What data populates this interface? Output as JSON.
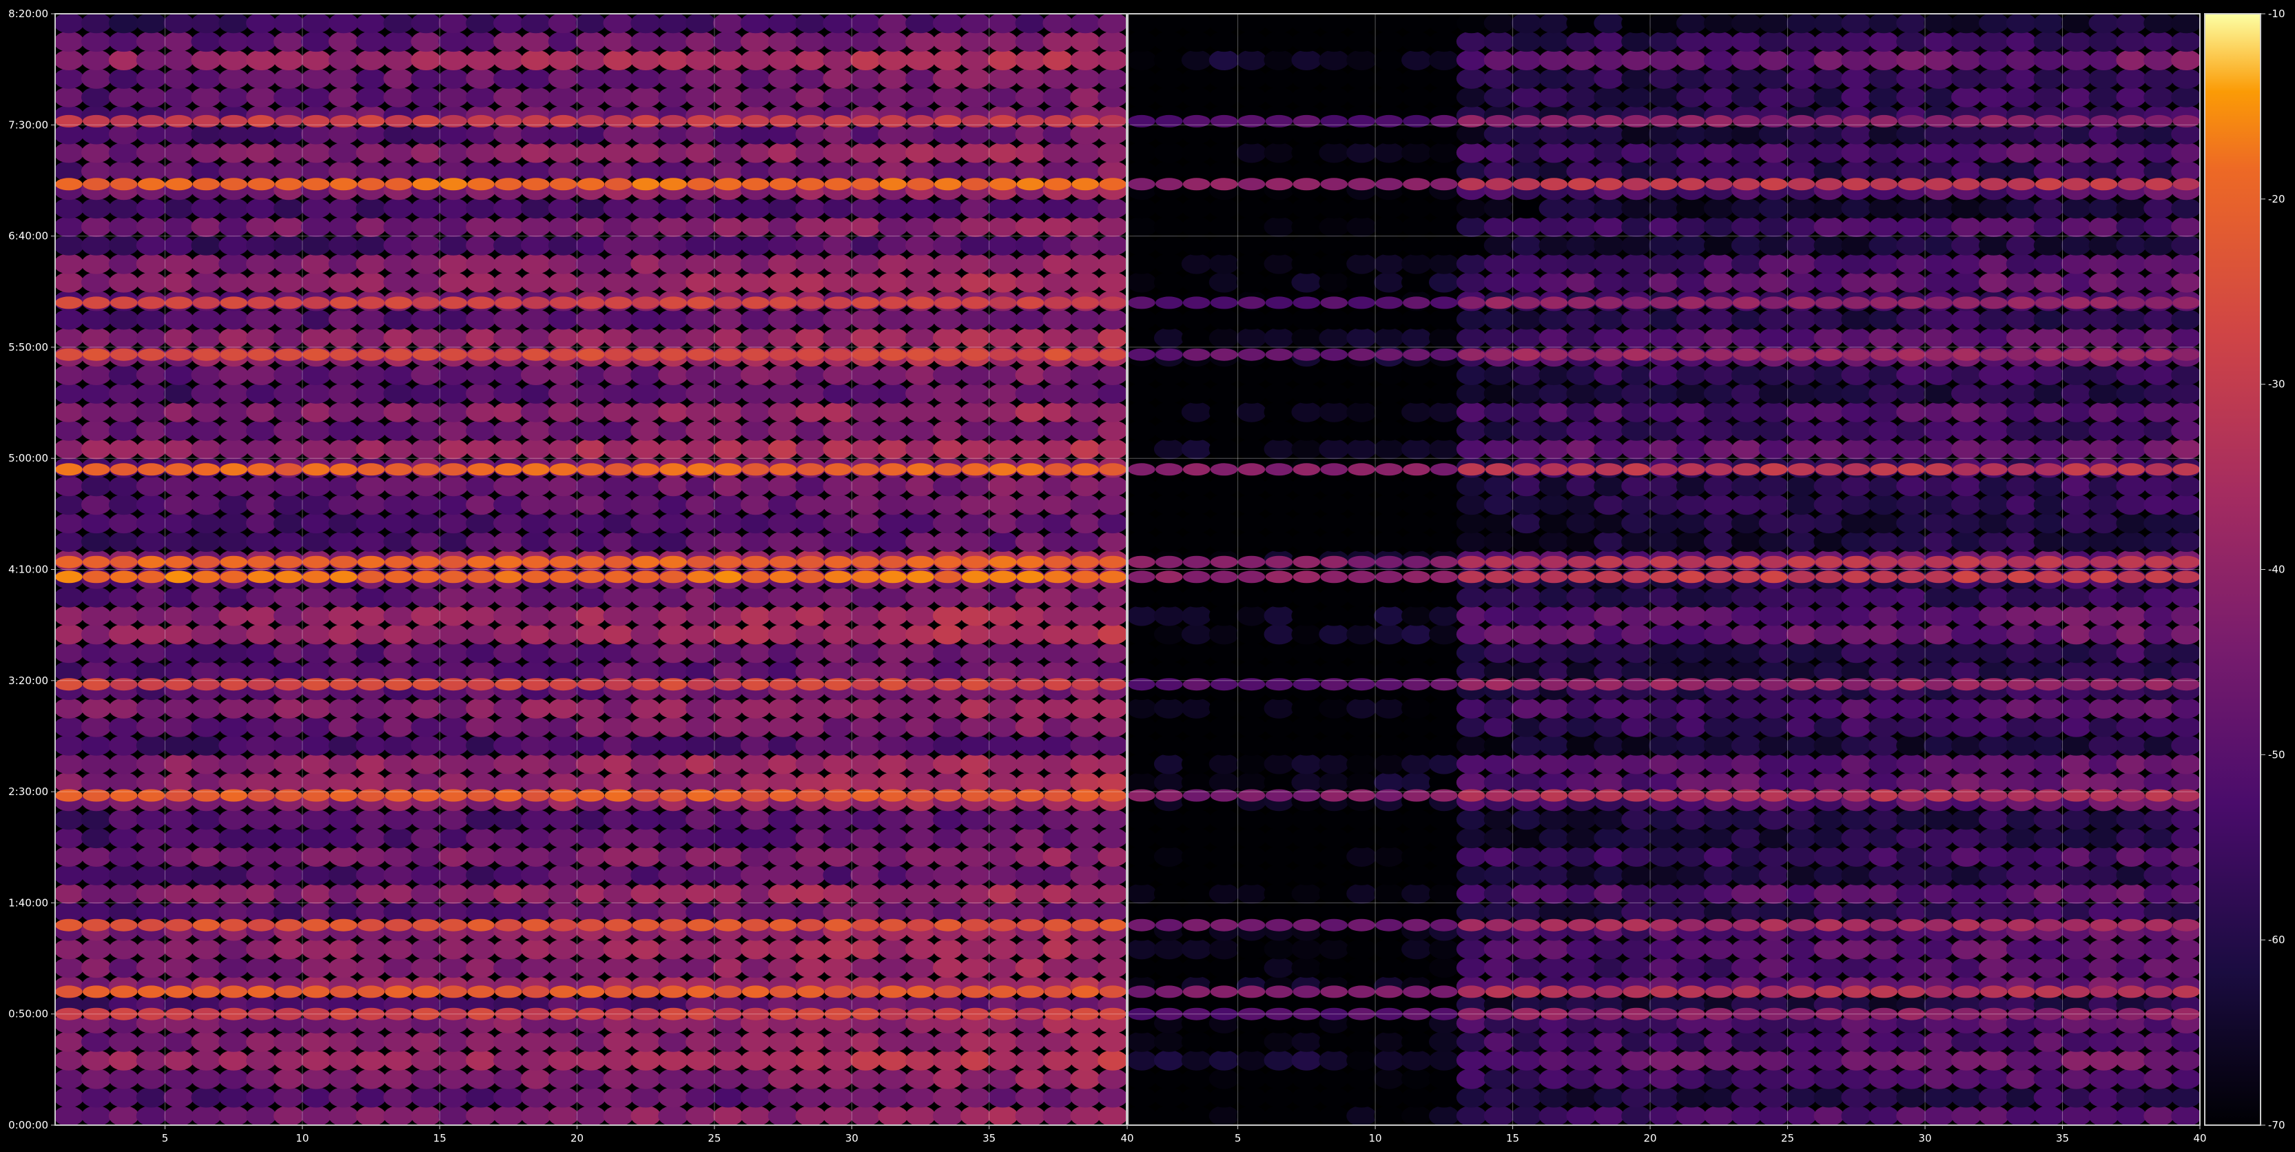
{
  "chart_data": {
    "type": "heatmap",
    "title": "",
    "xlabel": "",
    "ylabel": "",
    "colormap": "inferno",
    "background": "#000000",
    "grid": true,
    "colorbar": {
      "placement": "right",
      "range": [
        -70,
        -10
      ],
      "ticks": [
        -10,
        -20,
        -30,
        -40,
        -50,
        -60,
        -70
      ]
    },
    "y_axis": {
      "range_seconds": [
        0,
        30000
      ],
      "ticks": [
        {
          "label": "0:00:00",
          "seconds": 0
        },
        {
          "label": "0:50:00",
          "seconds": 3000
        },
        {
          "label": "1:40:00",
          "seconds": 6000
        },
        {
          "label": "2:30:00",
          "seconds": 9000
        },
        {
          "label": "3:20:00",
          "seconds": 12000
        },
        {
          "label": "4:10:00",
          "seconds": 15000
        },
        {
          "label": "5:00:00",
          "seconds": 18000
        },
        {
          "label": "5:50:00",
          "seconds": 21000
        },
        {
          "label": "6:40:00",
          "seconds": 24000
        },
        {
          "label": "7:30:00",
          "seconds": 27000
        },
        {
          "label": "8:20:00",
          "seconds": 30000
        }
      ]
    },
    "panels": [
      {
        "name": "",
        "x_range": [
          1,
          40
        ],
        "x_ticks": [
          5,
          10,
          15,
          20,
          25,
          30,
          35
        ],
        "level_offset": 0
      },
      {
        "name": "",
        "x_range": [
          1,
          40
        ],
        "x_ticks": [
          5,
          10,
          15,
          20,
          25,
          30,
          35
        ],
        "level_offset": -12
      }
    ],
    "shared_x_tick_labels": [
      {
        "label": "40"
      }
    ],
    "columns": 39,
    "rows": 60,
    "bands": [
      {
        "seconds": 5400,
        "level": -24
      },
      {
        "seconds": 3600,
        "level": -22
      },
      {
        "seconds": 14800,
        "level": -18
      },
      {
        "seconds": 15200,
        "level": -20
      },
      {
        "seconds": 17700,
        "level": -20
      },
      {
        "seconds": 25400,
        "level": -19
      },
      {
        "seconds": 8900,
        "level": -21
      },
      {
        "seconds": 3000,
        "level": -28
      },
      {
        "seconds": 11900,
        "level": -27
      },
      {
        "seconds": 22200,
        "level": -28
      },
      {
        "seconds": 20800,
        "level": -26
      },
      {
        "seconds": 27100,
        "level": -29
      }
    ]
  }
}
